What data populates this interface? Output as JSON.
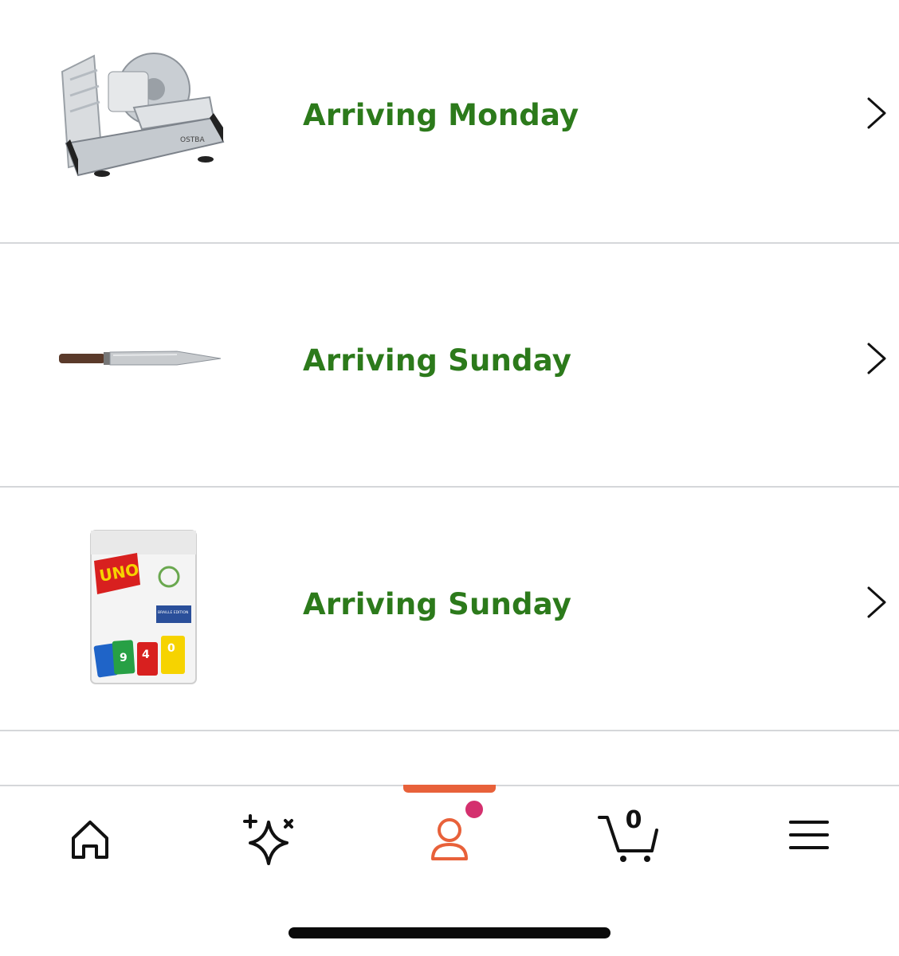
{
  "orders": [
    {
      "status": "Arriving Monday",
      "product_icon": "meat-slicer-image"
    },
    {
      "status": "Arriving Sunday",
      "product_icon": "chef-knife-image"
    },
    {
      "status": "Arriving Sunday",
      "product_icon": "uno-cards-image"
    }
  ],
  "product_labels": {
    "slicer_brand": "OSTBA",
    "uno_logo": "UNO",
    "uno_edition": "BRAILLE EDITION"
  },
  "tabbar": {
    "tabs": [
      {
        "name": "home",
        "icon": "home-icon"
      },
      {
        "name": "rufus",
        "icon": "sparkle-icon"
      },
      {
        "name": "you",
        "icon": "person-icon",
        "active": true
      },
      {
        "name": "cart",
        "icon": "cart-icon"
      },
      {
        "name": "menu",
        "icon": "hamburger-icon"
      }
    ],
    "cart_count": "0"
  },
  "colors": {
    "status_green": "#2c7a1b",
    "active_orange": "#e8613a",
    "notification_pink": "#d4306e"
  }
}
